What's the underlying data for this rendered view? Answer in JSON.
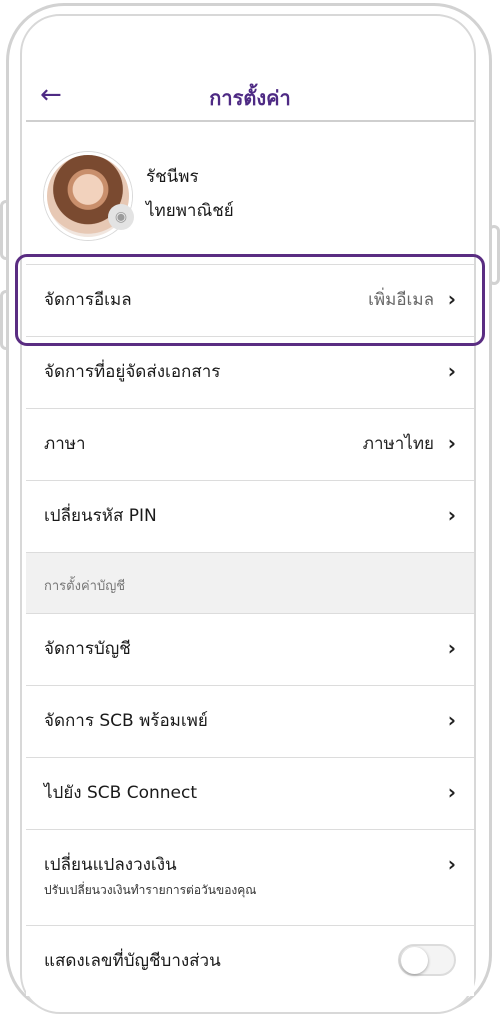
{
  "header": {
    "back_icon": "←",
    "title": "การตั้งค่า"
  },
  "profile": {
    "first_name": "รัชนีพร",
    "last_name": "ไทยพาณิชย์",
    "camera_icon": "camera-icon"
  },
  "rows": [
    {
      "label": "จัดการอีเมล",
      "value": "เพิ่มอีเมล"
    },
    {
      "label": "จัดการที่อยู่จัดส่งเอกสาร",
      "value": ""
    },
    {
      "label": "ภาษา",
      "value": "ภาษาไทย"
    },
    {
      "label": "เปลี่ยนรหัส PIN",
      "value": ""
    }
  ],
  "section_title": "การตั้งค่าบัญชี",
  "account_rows": [
    {
      "label": "จัดการบัญชี"
    },
    {
      "label": "จัดการ SCB พร้อมเพย์"
    },
    {
      "label": "ไปยัง SCB Connect"
    },
    {
      "label": "เปลี่ยนแปลงวงเงิน",
      "sub": "ปรับเปลี่ยนวงเงินทำรายการต่อวันของคุณ"
    },
    {
      "label": "แสดงเลขที่บัญชีบางส่วน",
      "toggle": false
    }
  ],
  "chevron": "›",
  "colors": {
    "accent": "#4e2a84",
    "highlight": "#5a2d82"
  }
}
